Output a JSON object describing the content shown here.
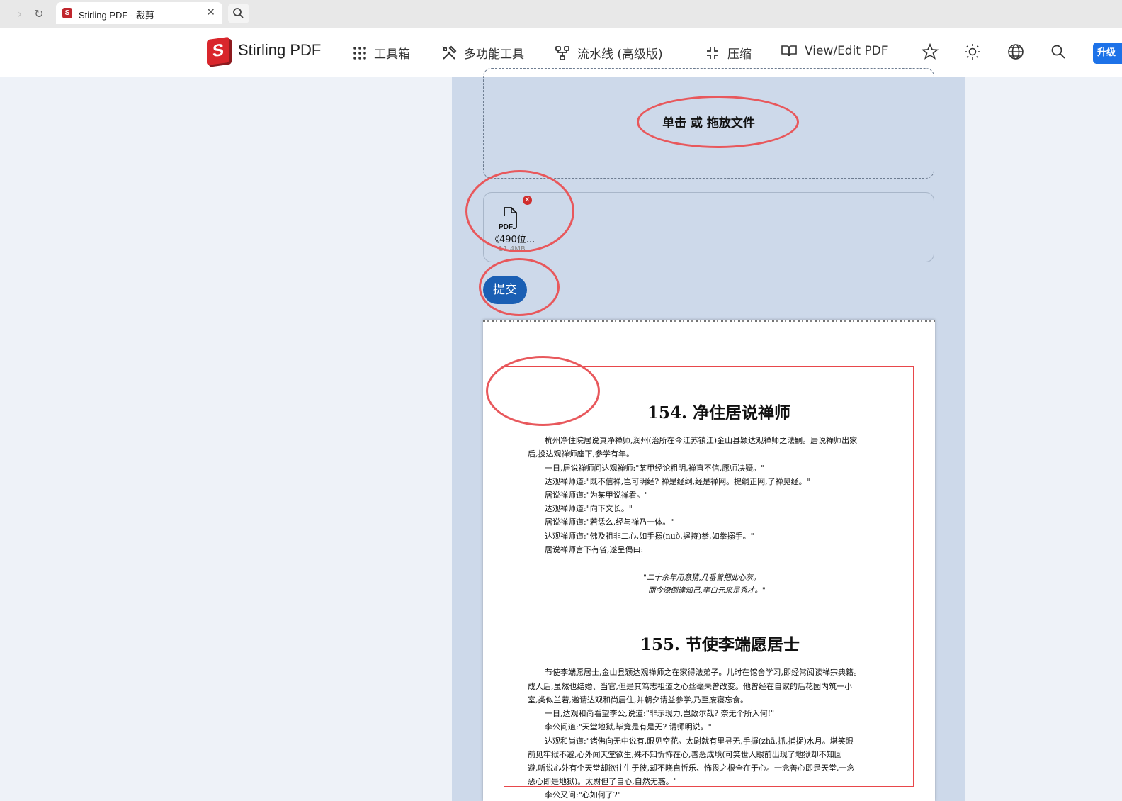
{
  "browser": {
    "tab_title": "Stirling PDF - 裁剪",
    "favicon_letter": "S"
  },
  "navbar": {
    "brand": "Stirling PDF",
    "logo_letter": "S",
    "items": [
      {
        "label": "工具箱",
        "icon": "grid-icon"
      },
      {
        "label": "多功能工具",
        "icon": "tools-icon"
      },
      {
        "label": "流水线 (高级版)",
        "icon": "pipeline-icon"
      },
      {
        "label": "压缩",
        "icon": "compress-icon"
      },
      {
        "label": "View/Edit PDF",
        "icon": "book-icon"
      }
    ],
    "right_icons": [
      "star-icon",
      "sun-icon",
      "globe-icon",
      "search-icon"
    ],
    "upgrade_label": "升级"
  },
  "colors": {
    "accent": "#1a5fb4",
    "brand_red": "#d9262c",
    "panel_bg": "#cdd9ea",
    "annotation": "#e8585c",
    "crop_box": "#e8474b"
  },
  "upload": {
    "dropzone_label": "单击 或 拖放文件",
    "file": {
      "type_label": "PDF",
      "name": "《490位...",
      "size": "11.4MB"
    },
    "submit_label": "提交"
  },
  "pdf_preview": {
    "sections": [
      {
        "title": "154. 净住居说禅师",
        "lines": [
          "杭州净住院居说真净禅师,润州(治所在今江苏镇江)金山县颖达观禅师之法嗣。居说禅师出家",
          "后,投达观禅师座下,参学有年。",
          "一日,居说禅师问达观禅师:\"某甲经论粗明,禅直不信,愿师决疑。\"",
          "达观禅师道:\"既不信禅,岂可明经? 禅是经纲,经是禅网。提纲正网,了禅见经。\"",
          "居说禅师道:\"为某甲说禅看。\"",
          "达观禅师道:\"向下文长。\"",
          "居说禅师道:\"若恁么,经与禅乃一体。\"",
          "达观禅师道:\"佛及祖非二心,如手搦(nuò,握持)拳,如拳搦手。\"",
          "居说禅师言下有省,遂呈偈曰:"
        ],
        "poem": [
          "\"二十余年用意猜,几番曾把此心灰。",
          "而今潦倒逢知己,李白元来是秀才。\""
        ]
      },
      {
        "title": "155. 节使李端愿居士",
        "lines": [
          "节使李端愿居士,金山县颖达观禅师之在家得法弟子。儿时在馆舍学习,即经常阅读禅宗典籍。",
          "成人后,虽然也结婚、当官,但是其笃志祖道之心丝毫未曾改变。他曾经在自家的后花园内筑一小",
          "室,类似兰若,邀请达观和尚居住,并朝夕请益参学,乃至废寝忘食。",
          "一日,达观和尚看望李公,说道:\"非示现力,岂致尔哉? 奈无个所入何!\"",
          "李公问道:\"天堂地狱,毕竟是有是无? 请师明说。\"",
          "达观和尚道:\"诸佛向无中说有,眼见空花。太尉就有里寻无,手攞(zhā,抓,捕捉)水月。堪笑眼",
          "前见牢狱不避,心外闻天堂欲生,殊不知忻怖在心,善恶成境(可笑世人眼前出现了地狱却不知回",
          "避,听说心外有个天堂却欲往生于彼,却不晓自忻乐、怖畏之根全在于心。一念善心即是天堂,一念",
          "恶心即是地狱)。太尉但了自心,自然无惑。\"",
          "李公又问:\"心如何了?\""
        ]
      }
    ]
  }
}
